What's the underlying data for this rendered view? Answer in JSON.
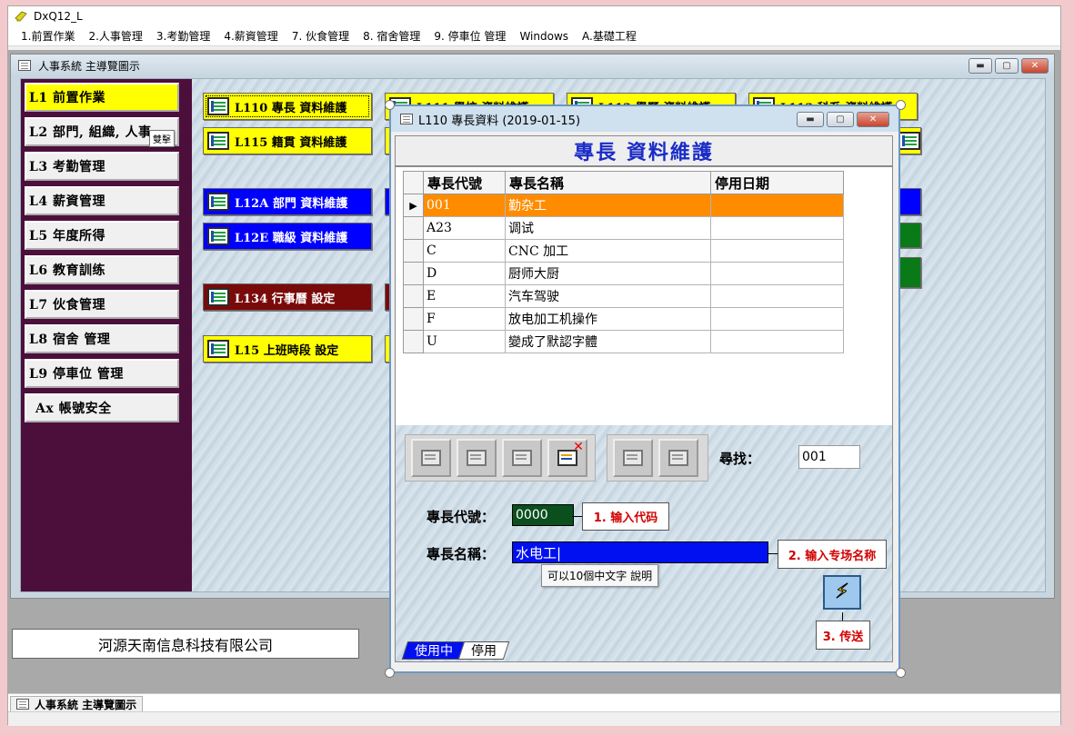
{
  "app": {
    "title": "DxQ12_L",
    "menu": [
      "1.前置作業",
      "2.人事管理",
      "3.考勤管理",
      "4.薪資管理",
      "7. 伙食管理",
      "8. 宿舍管理",
      "9. 停車位 管理",
      "Windows",
      "A.基礎工程"
    ]
  },
  "main_window": {
    "title": "人事系統 主導覽圖示",
    "buttons": {
      "minimize": "▬",
      "maximize": "▢",
      "close": "✕"
    },
    "left_menu": [
      "L1  前置作業",
      "L2  部門, 組織, 人事",
      "L3  考勤管理",
      "L4  薪資管理",
      "L5  年度所得",
      "L6  教育訓练",
      "L7  伙食管理",
      "L8  宿舍  管理",
      "L9  停車位  管理",
      "Ax  帳號安全"
    ],
    "tooltip": "雙擊",
    "menu_buttons": {
      "l110": "L110  專長  資料維護",
      "l111": "L111  學校  資料維護",
      "l112": "L112  學歷  資料維護",
      "l113": "L113  科系  資料維護",
      "l115": "L115  籍貫  資料維護",
      "l12a": "L12A  部門  資料維護",
      "l12e": "L12E  職級  資料維護",
      "l134": "L134  行事曆  設定",
      "l15": "L15  上班時段  設定"
    },
    "company": "河源天南信息科技有限公司"
  },
  "taskbar": {
    "tab_label": "人事系統 主導覽圖示"
  },
  "form_window": {
    "title": "L110 專長資料 (2019-01-15)",
    "buttons": {
      "minimize": "▬",
      "maximize": "▢",
      "close": "✕"
    },
    "banner": "專長 資料維護",
    "grid": {
      "columns": [
        "專長代號",
        "專長名稱",
        "停用日期"
      ],
      "rows": [
        [
          "001",
          "勤杂工",
          ""
        ],
        [
          "A23",
          "调试",
          ""
        ],
        [
          "C",
          "CNC 加工",
          ""
        ],
        [
          "D",
          "厨师大厨",
          ""
        ],
        [
          "E",
          "汽车驾驶",
          ""
        ],
        [
          "F",
          "放电加工机操作",
          ""
        ],
        [
          "U",
          "變成了默認字體",
          ""
        ]
      ],
      "row_indicator": "▶"
    },
    "search_label": "尋找：",
    "search_value": "001",
    "code_label": "專長代號：",
    "code_value": "0000",
    "name_label": "專長名稱：",
    "name_value": "水电工|",
    "hint": "可以10個中文字 說明",
    "tabs": [
      "使用中",
      "停用"
    ],
    "annotations": [
      "1. 输入代码",
      "2. 输入专场名称",
      "3. 传送"
    ]
  }
}
